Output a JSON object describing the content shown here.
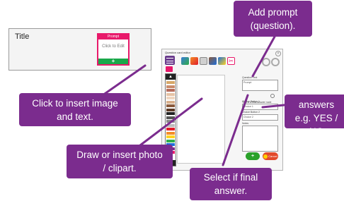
{
  "thumbnail": {
    "title_label": "Title",
    "card_header": "Prompt",
    "card_body_line1": "Click to Edit",
    "card_add_symbol": "+"
  },
  "editor": {
    "window_title": "Question card editor",
    "close_symbol": "×",
    "palette_up": "▲",
    "palette_down": "▼",
    "question_label": "Question Text",
    "question_value": "Prompt",
    "final_answer_label": "This is a final answer node",
    "choice1_label": "Choice Button 1",
    "choice1_value": "Choice 1",
    "choice2_label": "Choice Button 2",
    "choice2_value": "Choice 2",
    "notes_label": "Notes",
    "ok_symbol": "+",
    "cancel_label": "Cancel"
  },
  "callouts": {
    "add_prompt": "Add prompt\n(question).",
    "insert_image": "Click to insert image\nand text.",
    "insert_answers": "Insert answers\ne.g. YES / NO",
    "draw_photo": "Draw or insert photo\n/ clipart.",
    "final_answer": "Select if final\nanswer."
  },
  "colors": {
    "callout": "#7b2c8e",
    "card_accent": "#e8196a",
    "add_green": "#19a84a",
    "cancel_red": "#e24a2b"
  },
  "palette_swatches": [
    "#d6a86a",
    "#c98b6b",
    "#b56b5b",
    "#e6c3a6",
    "#f0d6c0",
    "#d9b08c",
    "#8a5a3c",
    "#5b3a26",
    "#222222",
    "#555555",
    "#888888",
    "#bbbbbb",
    "#e11d2a",
    "#f28c28",
    "#ffd21f",
    "#2fae4a",
    "#1e6fd9",
    "#7b2c8e",
    "#e8196a",
    "#ffffff"
  ],
  "toolbar_icons": [
    "paint-icon",
    "picture-icon",
    "frame-icon",
    "clipart-icon",
    "shape-icon",
    "scissors-icon"
  ]
}
